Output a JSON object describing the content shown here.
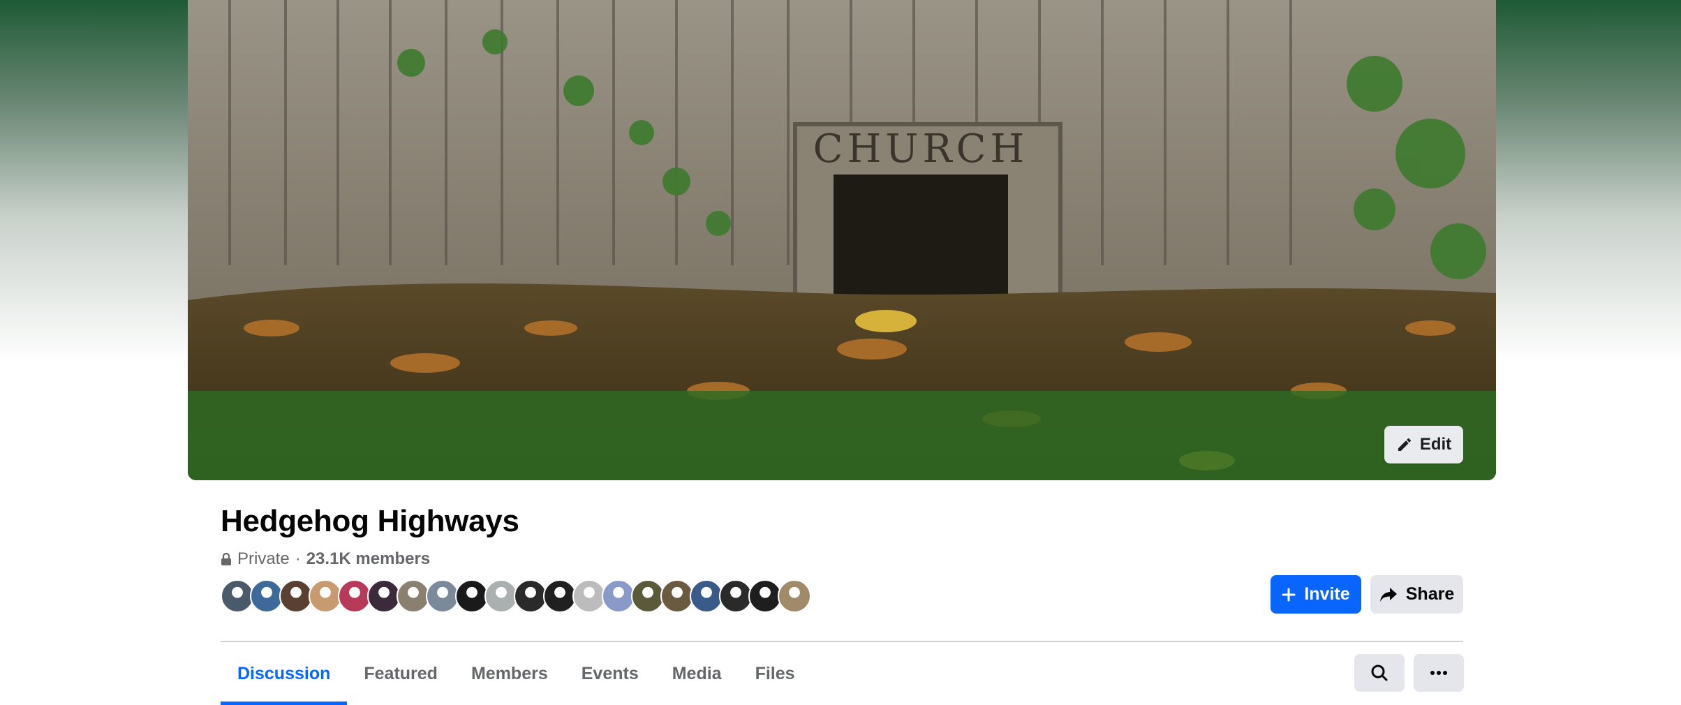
{
  "cover": {
    "sign_text": "CHURCH",
    "edit_label": "Edit",
    "edit_icon": "pencil-icon"
  },
  "group": {
    "name": "Hedgehog Highways",
    "privacy": "Private",
    "separator": "·",
    "members": "23.1K members",
    "privacy_icon": "lock-icon"
  },
  "member_avatars": {
    "count": 20,
    "colors": [
      "#4a5a6a",
      "#3d6a9a",
      "#5a4030",
      "#c89a70",
      "#b83a5a",
      "#3a2a3a",
      "#8a8070",
      "#7a8a9a",
      "#1a1a1a",
      "#aab0b0",
      "#2a2a2a",
      "#202020",
      "#bcbcbc",
      "#8a9ac8",
      "#5a5a3a",
      "#6a5a40",
      "#3a5a8a",
      "#2a2a2a",
      "#1e1e1e",
      "#a08a6a"
    ]
  },
  "actions": {
    "invite_label": "Invite",
    "invite_icon": "plus-icon",
    "share_label": "Share",
    "share_icon": "share-arrow-icon",
    "accent": "#0866ff"
  },
  "tabs": [
    {
      "label": "Discussion",
      "active": true
    },
    {
      "label": "Featured",
      "active": false
    },
    {
      "label": "Members",
      "active": false
    },
    {
      "label": "Events",
      "active": false
    },
    {
      "label": "Media",
      "active": false
    },
    {
      "label": "Files",
      "active": false
    }
  ],
  "toolbar": {
    "search_icon": "search-icon",
    "more_icon": "more-dots-icon"
  }
}
